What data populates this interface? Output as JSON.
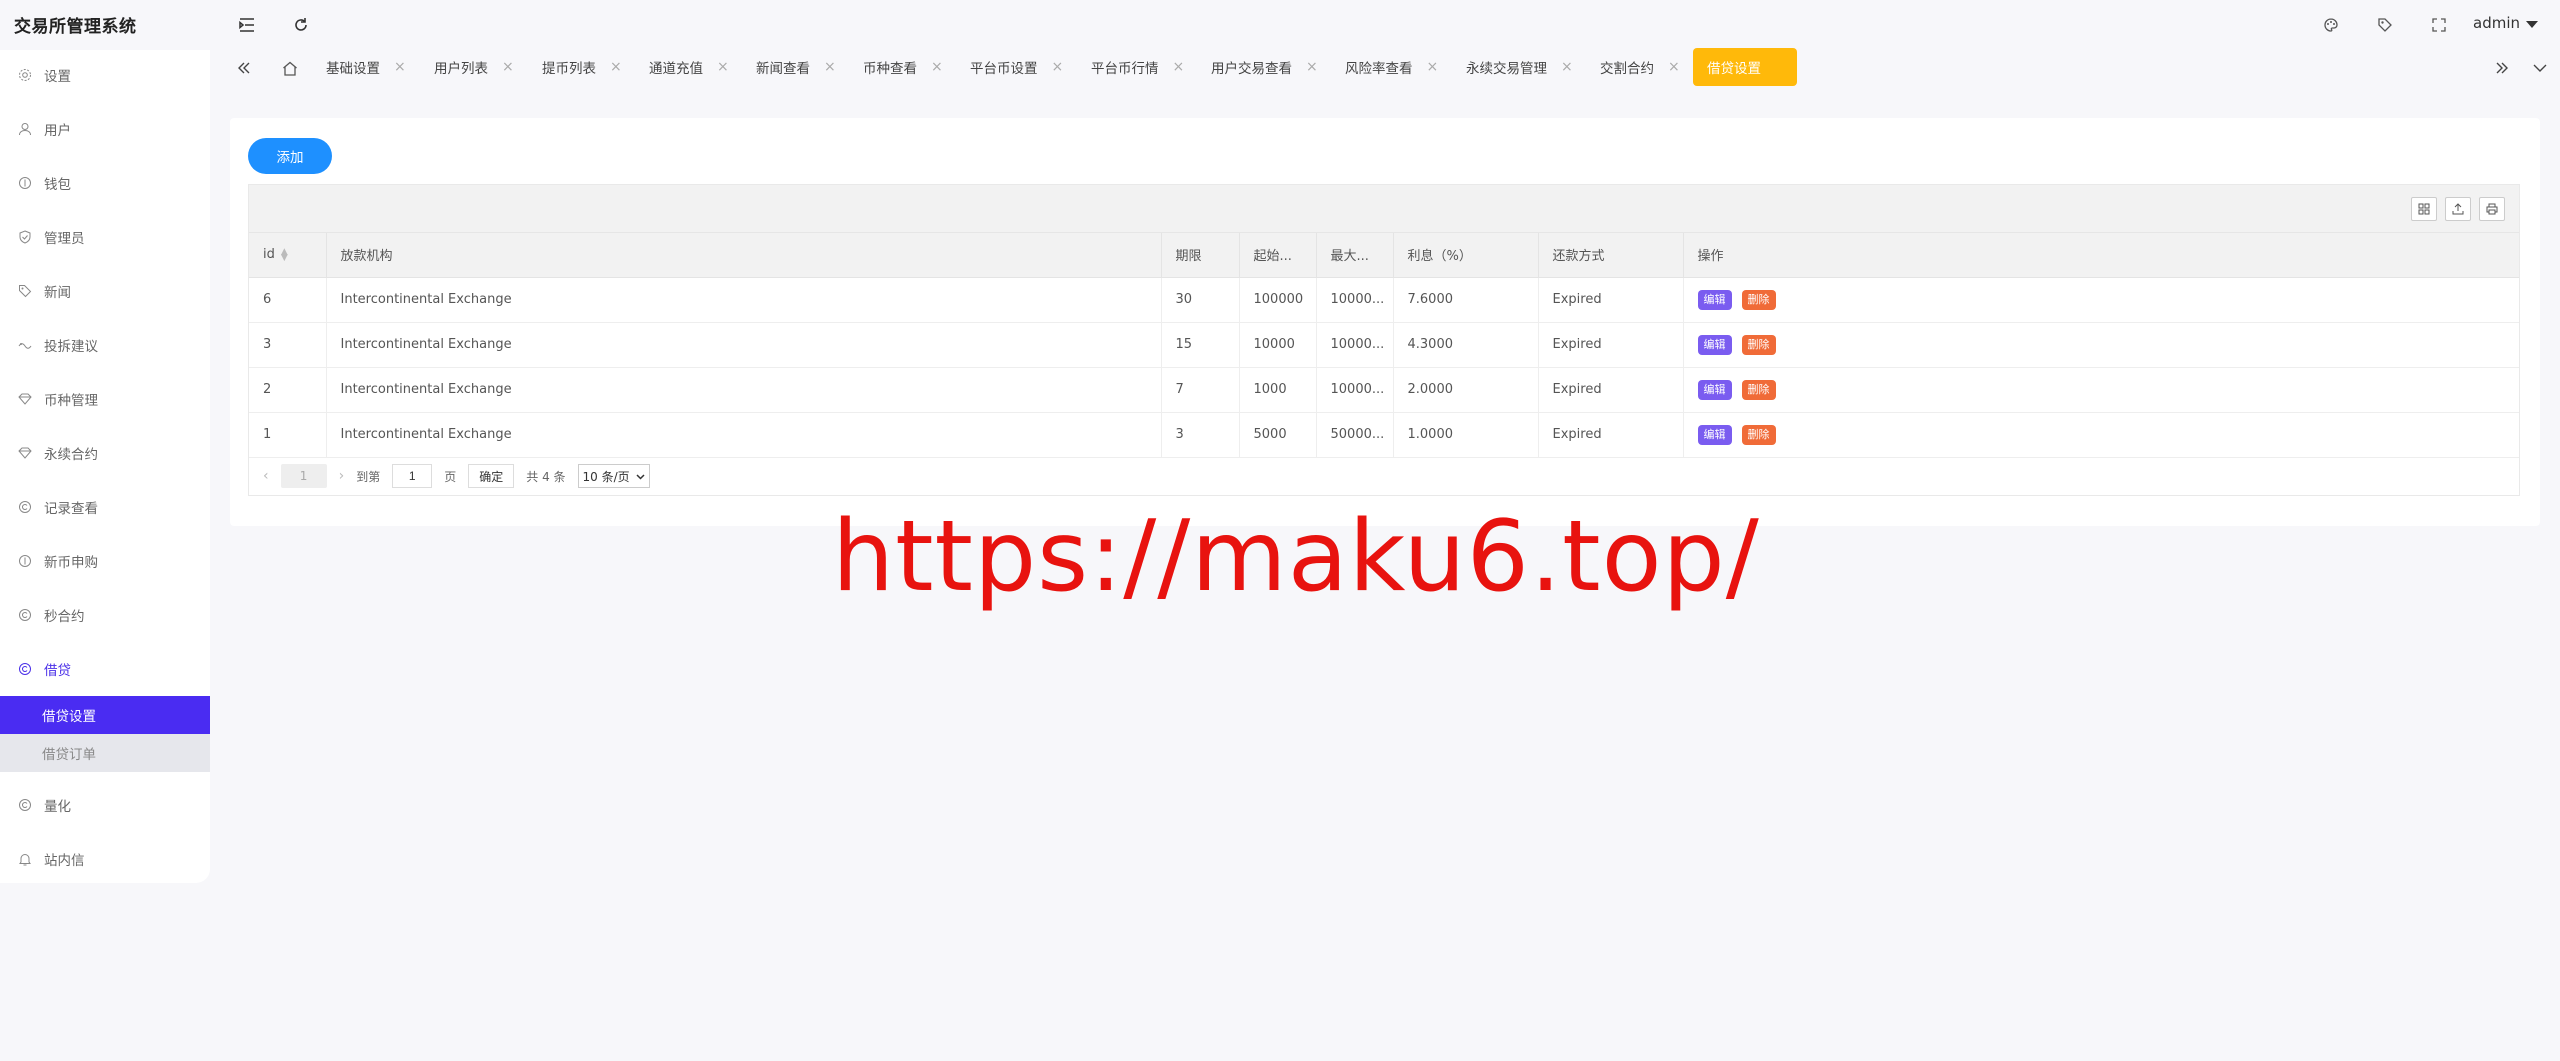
{
  "app": {
    "title": "交易所管理系统"
  },
  "header": {
    "user": "admin"
  },
  "sidebar": {
    "items": [
      {
        "label": "设置",
        "icon": "gear-icon"
      },
      {
        "label": "用户",
        "icon": "user-icon"
      },
      {
        "label": "钱包",
        "icon": "wallet-icon"
      },
      {
        "label": "管理员",
        "icon": "shield-icon"
      },
      {
        "label": "新闻",
        "icon": "tag-icon"
      },
      {
        "label": "投拆建议",
        "icon": "feedback-icon"
      },
      {
        "label": "币种管理",
        "icon": "diamond-icon"
      },
      {
        "label": "永续合约",
        "icon": "diamond-icon"
      },
      {
        "label": "记录查看",
        "icon": "record-icon"
      },
      {
        "label": "新币申购",
        "icon": "coin-icon"
      },
      {
        "label": "秒合约",
        "icon": "contract-icon"
      },
      {
        "label": "借贷",
        "icon": "loan-icon"
      }
    ],
    "sub_items": [
      {
        "label": "借贷设置"
      },
      {
        "label": "借贷订单"
      }
    ],
    "after_items": [
      {
        "label": "量化",
        "icon": "quant-icon"
      },
      {
        "label": "站内信",
        "icon": "bell-icon"
      }
    ]
  },
  "tabs": [
    {
      "label": "基础设置"
    },
    {
      "label": "用户列表"
    },
    {
      "label": "提币列表"
    },
    {
      "label": "通道充值"
    },
    {
      "label": "新闻查看"
    },
    {
      "label": "币种查看"
    },
    {
      "label": "平台币设置"
    },
    {
      "label": "平台币行情"
    },
    {
      "label": "用户交易查看"
    },
    {
      "label": "风险率查看"
    },
    {
      "label": "永续交易管理"
    },
    {
      "label": "交割合约"
    },
    {
      "label": "借贷设置"
    }
  ],
  "main": {
    "add_label": "添加",
    "columns": [
      "id",
      "放款机构",
      "期限",
      "起始...",
      "最大...",
      "利息（%）",
      "还款方式",
      "操作"
    ],
    "rows": [
      {
        "id": "6",
        "org": "Intercontinental Exchange",
        "term": "30",
        "start": "100000",
        "max": "10000...",
        "rate": "7.6000",
        "repay": "Expired"
      },
      {
        "id": "3",
        "org": "Intercontinental Exchange",
        "term": "15",
        "start": "10000",
        "max": "10000...",
        "rate": "4.3000",
        "repay": "Expired"
      },
      {
        "id": "2",
        "org": "Intercontinental Exchange",
        "term": "7",
        "start": "1000",
        "max": "10000...",
        "rate": "2.0000",
        "repay": "Expired"
      },
      {
        "id": "1",
        "org": "Intercontinental Exchange",
        "term": "3",
        "start": "5000",
        "max": "50000...",
        "rate": "1.0000",
        "repay": "Expired"
      }
    ],
    "edit_label": "编辑",
    "delete_label": "删除",
    "pager": {
      "current": "1",
      "goto_label": "到第",
      "goto_value": "1",
      "page_unit": "页",
      "confirm": "确定",
      "total": "共 4 条",
      "per_page": "10 条/页"
    }
  },
  "watermark": "https://maku6.top/"
}
